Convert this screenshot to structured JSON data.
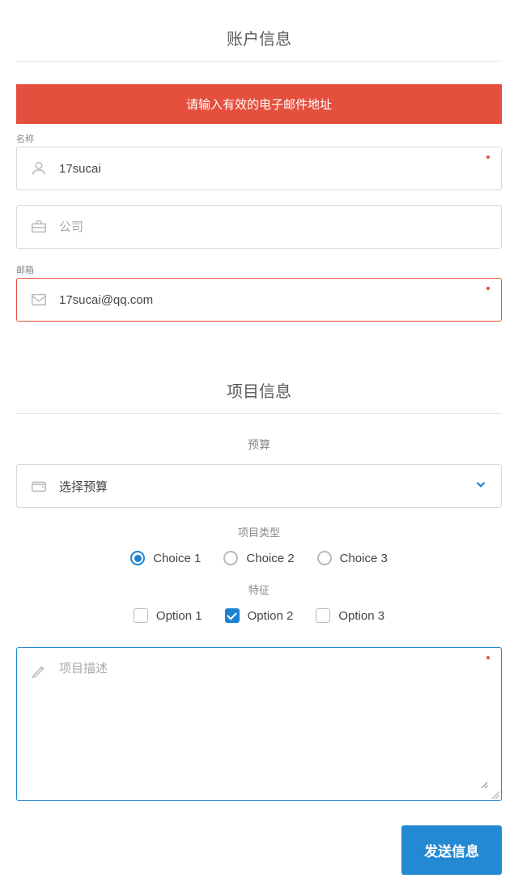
{
  "sections": {
    "account_title": "账户信息",
    "project_title": "项目信息"
  },
  "alert": {
    "message": "请输入有效的电子邮件地址"
  },
  "fields": {
    "name": {
      "label": "名称",
      "value": "17sucai",
      "placeholder": "名称",
      "required": true
    },
    "company": {
      "label": "",
      "value": "",
      "placeholder": "公司",
      "required": false
    },
    "email": {
      "label": "邮箱",
      "value": "17sucai@qq.com",
      "placeholder": "邮箱",
      "required": true,
      "error": true
    },
    "budget": {
      "label": "预算",
      "selected": "选择预算"
    },
    "project_type": {
      "label": "项目类型",
      "options": [
        "Choice 1",
        "Choice 2",
        "Choice 3"
      ],
      "selected": 0
    },
    "features": {
      "label": "特征",
      "options": [
        "Option 1",
        "Option 2",
        "Option 3"
      ],
      "checked": [
        1
      ]
    },
    "description": {
      "placeholder": "项目描述",
      "value": "",
      "required": true
    }
  },
  "actions": {
    "submit": "发送信息"
  },
  "colors": {
    "accent": "#1b84d1",
    "error": "#e44f3e",
    "submit": "#2389d3"
  }
}
